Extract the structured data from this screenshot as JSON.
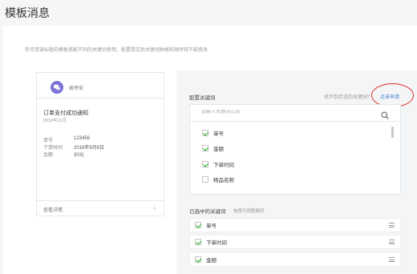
{
  "page_title": "模板消息",
  "tip": "你可用该标题的模板搭配不同的关键词使用，配置提交后关键词种类和顺序将不能修改",
  "preview": {
    "account_name": "君帝安",
    "template_title": "订单支付成功通知",
    "date": "2018年11月",
    "fields": [
      {
        "key": "单号",
        "value": "123456"
      },
      {
        "key": "下单时间",
        "value": "2016年8月8日"
      },
      {
        "key": "金额",
        "value": "30元"
      }
    ],
    "detail_label": "查看详情",
    "detail_arrow": "›"
  },
  "keywords": {
    "label": "配置关键词",
    "hint": "找不到合适的关键词？",
    "apply_link": "点击申请",
    "search_placeholder": "请输入关键词过滤",
    "options": [
      {
        "label": "单号",
        "checked": true
      },
      {
        "label": "金额",
        "checked": true
      },
      {
        "label": "下单时间",
        "checked": true
      },
      {
        "label": "物品名称",
        "checked": false
      }
    ]
  },
  "selected": {
    "label": "已选中的关键词",
    "sub": "拖拽可调整顺序",
    "items": [
      {
        "label": "单号",
        "checked": true
      },
      {
        "label": "下单时间",
        "checked": true
      },
      {
        "label": "金额",
        "checked": true
      }
    ]
  },
  "colors": {
    "accent_green": "#1aad19",
    "link_blue": "#3a7fd5",
    "annotation_red": "#e0342b",
    "avatar": "#7b73d6"
  },
  "icons": {
    "search": "search-icon",
    "drag": "drag-handle-icon",
    "avatar": "wechat-avatar-icon"
  }
}
